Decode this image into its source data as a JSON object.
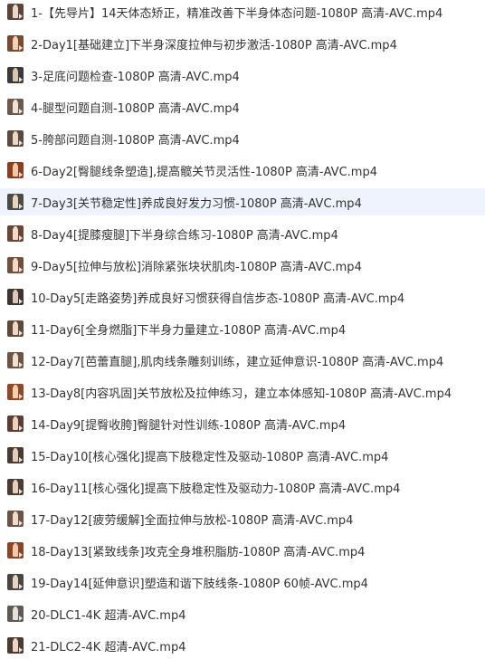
{
  "files": [
    {
      "name": "1-【先导片】14天体态矫正，精准改善下半身体态问题-1080P 高清-AVC.mp4",
      "icon": "video-thumbnail-icon",
      "thumb_bg": "#5a4538",
      "thumb_fig": "#e9d9c8"
    },
    {
      "name": "2-Day1[基础建立]下半身深度拉伸与初步激活-1080P 高清-AVC.mp4",
      "icon": "video-thumbnail-icon",
      "thumb_bg": "#7a4a2e",
      "thumb_fig": "#f0d2b8"
    },
    {
      "name": "3-足底问题检查-1080P 高清-AVC.mp4",
      "icon": "video-thumbnail-icon",
      "thumb_bg": "#3a3a3a",
      "thumb_fig": "#d8c4b0"
    },
    {
      "name": "4-腿型问题自测-1080P 高清-AVC.mp4",
      "icon": "video-thumbnail-icon",
      "thumb_bg": "#6b5a4c",
      "thumb_fig": "#efe2d4"
    },
    {
      "name": "5-胯部问题自测-1080P 高清-AVC.mp4",
      "icon": "video-thumbnail-icon",
      "thumb_bg": "#5c4a40",
      "thumb_fig": "#ead8c6"
    },
    {
      "name": "6-Day2[臀腿线条塑造],提高髋关节灵活性-1080P 高清-AVC.mp4",
      "icon": "video-thumbnail-icon",
      "thumb_bg": "#8a3f22",
      "thumb_fig": "#f2c9a8"
    },
    {
      "name": "7-Day3[关节稳定性]养成良好发力习惯-1080P 高清-AVC.mp4",
      "icon": "video-thumbnail-icon",
      "thumb_bg": "#4e4a44",
      "thumb_fig": "#e6d6c4"
    },
    {
      "name": "8-Day4[提膝瘦腿]下半身综合练习-1080P 高清-AVC.mp4",
      "icon": "video-thumbnail-icon",
      "thumb_bg": "#6a4434",
      "thumb_fig": "#f1dccb"
    },
    {
      "name": "9-Day5[拉伸与放松]消除紧张块状肌肉-1080P 高清-AVC.mp4",
      "icon": "video-thumbnail-icon",
      "thumb_bg": "#72503e",
      "thumb_fig": "#f3dcc6"
    },
    {
      "name": "10-Day5[走路姿势]养成良好习惯获得自信步态-1080P 高清-AVC.mp4",
      "icon": "video-thumbnail-icon",
      "thumb_bg": "#3e3434",
      "thumb_fig": "#dcc8b6"
    },
    {
      "name": "11-Day6[全身燃脂]下半身力量建立-1080P 高清-AVC.mp4",
      "icon": "video-thumbnail-icon",
      "thumb_bg": "#5e4838",
      "thumb_fig": "#edd8c4"
    },
    {
      "name": "12-Day7[芭蕾直腿],肌肉线条雕刻训练，建立延伸意识-1080P 高清-AVC.mp4",
      "icon": "video-thumbnail-icon",
      "thumb_bg": "#6e5444",
      "thumb_fig": "#f2e0cf"
    },
    {
      "name": "13-Day8[内容巩固]关节放松及拉伸练习，建立本体感知-1080P 高清-AVC.mp4",
      "icon": "video-thumbnail-icon",
      "thumb_bg": "#8c4a2a",
      "thumb_fig": "#f4cfae"
    },
    {
      "name": "14-Day9[提臀收胯]臀腿针对性训练-1080P 高清-AVC.mp4",
      "icon": "video-thumbnail-icon",
      "thumb_bg": "#5a3e34",
      "thumb_fig": "#ecd2be"
    },
    {
      "name": "15-Day10[核心强化]提高下肢稳定性及驱动-1080P 高清-AVC.mp4",
      "icon": "video-thumbnail-icon",
      "thumb_bg": "#4a3c34",
      "thumb_fig": "#e4cfbc"
    },
    {
      "name": "16-Day11[核心强化]提高下肢稳定性及驱动力-1080P 高清-AVC.mp4",
      "icon": "video-thumbnail-icon",
      "thumb_bg": "#4a3c34",
      "thumb_fig": "#e4cfbc"
    },
    {
      "name": "17-Day12[疲劳缓解]全面拉伸与放松-1080P 高清-AVC.mp4",
      "icon": "video-thumbnail-icon",
      "thumb_bg": "#6c5446",
      "thumb_fig": "#f0dccb"
    },
    {
      "name": "18-Day13[紧致线条]攻克全身堆积脂肪-1080P 高清-AVC.mp4",
      "icon": "video-thumbnail-icon",
      "thumb_bg": "#8a4428",
      "thumb_fig": "#f3cbaa"
    },
    {
      "name": "19-Day14[延伸意识]塑造和谐下肢线条-1080P 60帧-AVC.mp4",
      "icon": "video-thumbnail-icon",
      "thumb_bg": "#4c4640",
      "thumb_fig": "#e2d4c6"
    },
    {
      "name": "20-DLC1-4K 超清-AVC.mp4",
      "icon": "video-thumbnail-icon",
      "thumb_bg": "#5e5a56",
      "thumb_fig": "#e8e0d8"
    },
    {
      "name": "21-DLC2-4K 超清-AVC.mp4",
      "icon": "video-thumbnail-icon",
      "thumb_bg": "#4a3a30",
      "thumb_fig": "#ead6c2"
    }
  ],
  "selected_index": 6,
  "colors": {
    "text": "#333333",
    "selected_bg": "#eef3fd",
    "background": "#ffffff"
  }
}
